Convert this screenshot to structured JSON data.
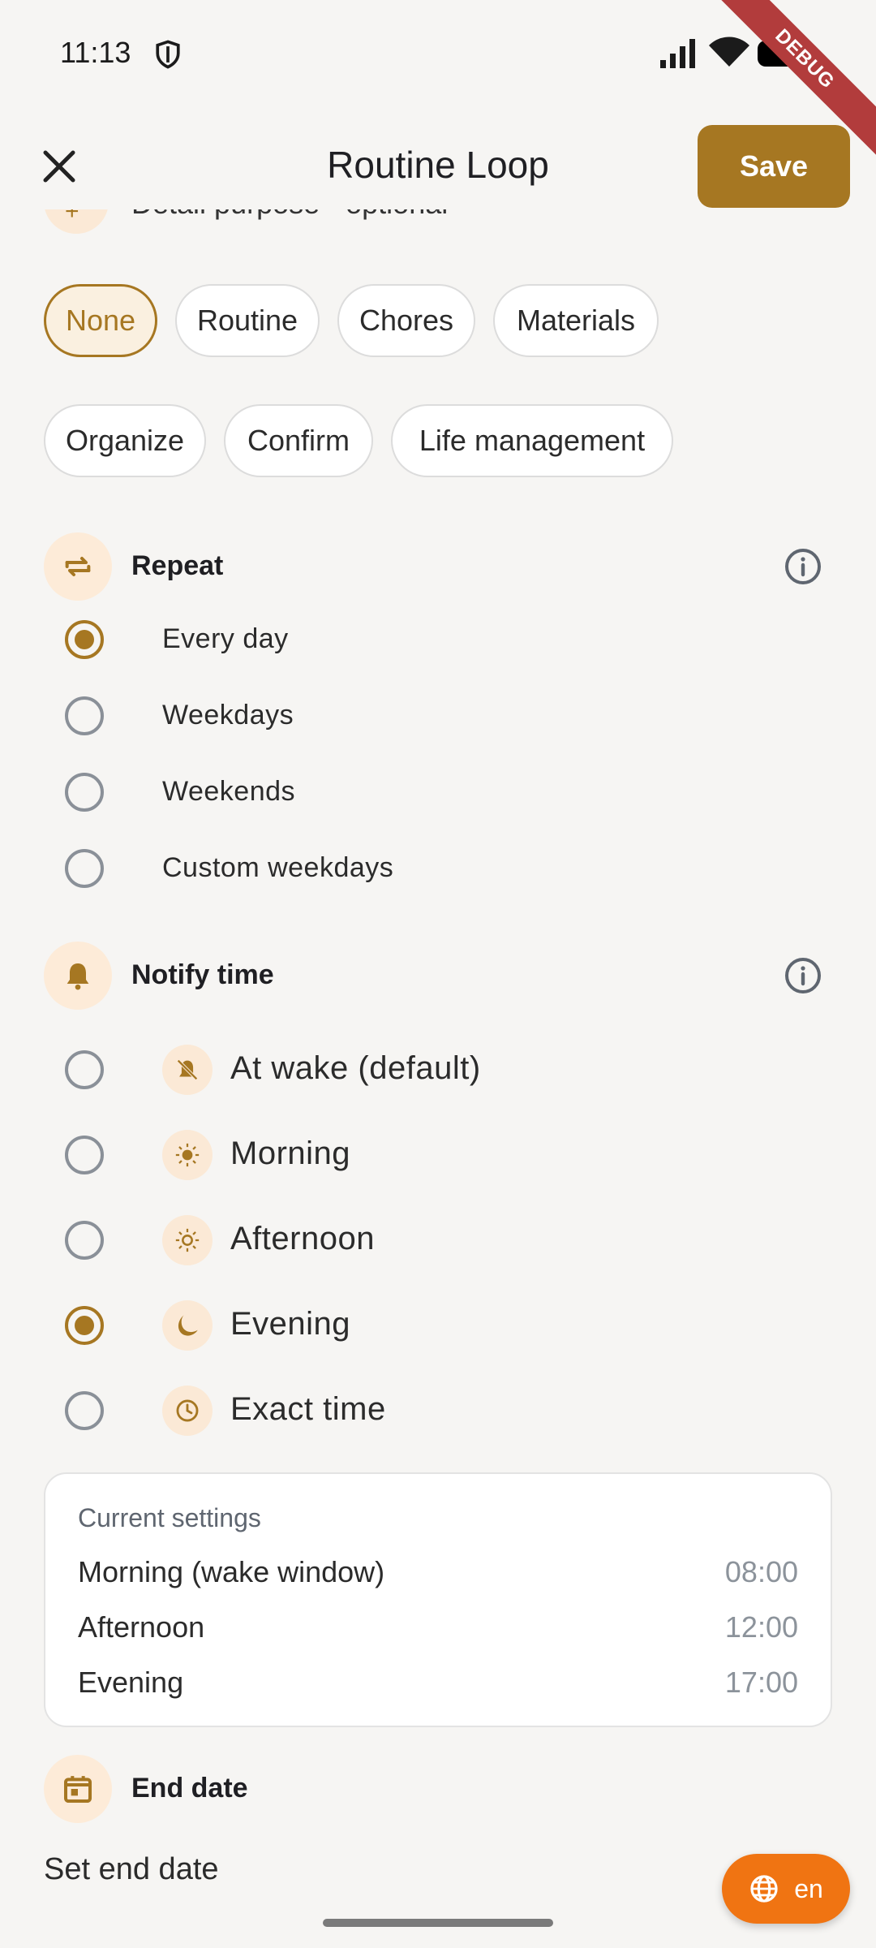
{
  "status_bar": {
    "time": "11:13",
    "debug_label": "DEBUG"
  },
  "app_bar": {
    "title": "Routine Loop",
    "save_label": "Save"
  },
  "detail_purpose": {
    "label": "Detail purpose - optional"
  },
  "chips": {
    "items": [
      "None",
      "Routine",
      "Chores",
      "Materials",
      "Organize",
      "Confirm",
      "Life management"
    ],
    "selected": "None"
  },
  "repeat": {
    "title": "Repeat",
    "options": [
      "Every day",
      "Weekdays",
      "Weekends",
      "Custom weekdays"
    ],
    "selected": "Every day"
  },
  "notify": {
    "title": "Notify time",
    "options": [
      "At wake (default)",
      "Morning",
      "Afternoon",
      "Evening",
      "Exact time"
    ],
    "icons": [
      "bell-off-icon",
      "sun-icon",
      "sun-icon",
      "moon-icon",
      "clock-icon"
    ],
    "selected": "Evening"
  },
  "current_settings": {
    "title": "Current settings",
    "rows": [
      {
        "label": "Morning (wake window)",
        "value": "08:00"
      },
      {
        "label": "Afternoon",
        "value": "12:00"
      },
      {
        "label": "Evening",
        "value": "17:00"
      }
    ]
  },
  "end_date": {
    "title": "End date",
    "link": "Set end date"
  },
  "language": {
    "label": "en"
  },
  "colors": {
    "accent": "#a67722",
    "fab": "#f07412",
    "icon_bg": "#fdebd8"
  }
}
